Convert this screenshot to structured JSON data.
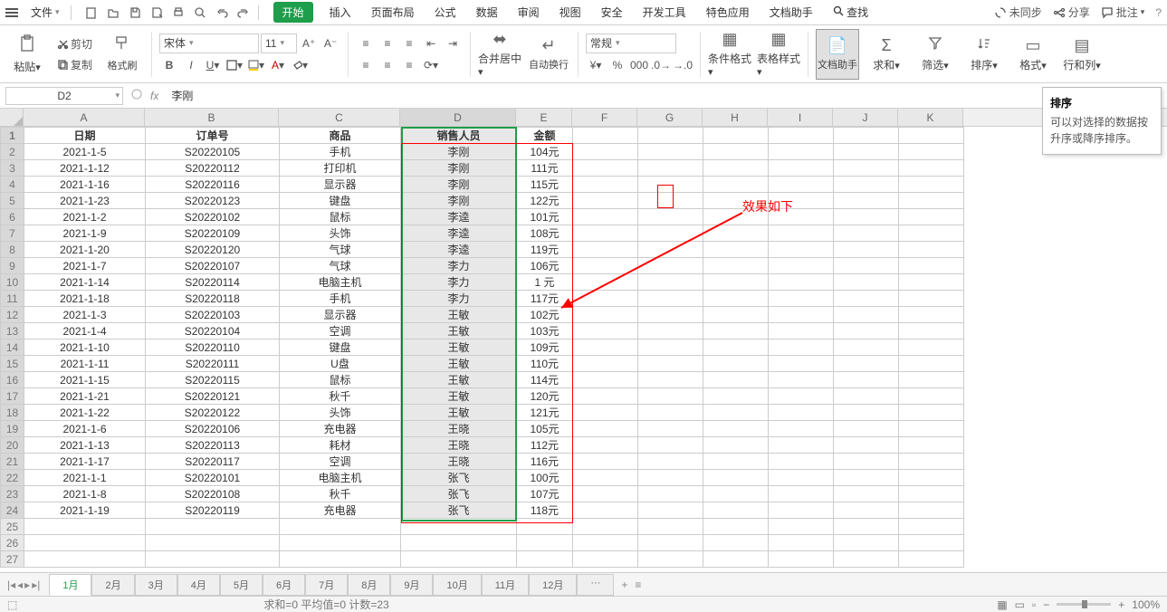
{
  "menu": {
    "file": "文件",
    "tabs": [
      "开始",
      "插入",
      "页面布局",
      "公式",
      "数据",
      "审阅",
      "视图",
      "安全",
      "开发工具",
      "特色应用",
      "文档助手"
    ],
    "search": "查找",
    "unsync": "未同步",
    "share": "分享",
    "comment": "批注"
  },
  "ribbon": {
    "paste": "粘贴",
    "cut": "剪切",
    "copy": "复制",
    "brush": "格式刷",
    "font": "宋体",
    "size": "11",
    "merge": "合并居中",
    "wrap": "自动换行",
    "numfmt": "常规",
    "cond": "条件格式",
    "tblstyle": "表格样式",
    "helper": "文档助手",
    "sum": "求和",
    "filter": "筛选",
    "sort": "排序",
    "format": "格式",
    "rowcol": "行和列"
  },
  "tooltip": {
    "title": "排序",
    "body": "可以对选择的数据按升序或降序排序。"
  },
  "namebox": "D2",
  "formula": "李刚",
  "cols": [
    "A",
    "B",
    "C",
    "D",
    "E",
    "F",
    "G",
    "H",
    "I",
    "J",
    "K"
  ],
  "headers": [
    "日期",
    "订单号",
    "商品",
    "销售人员",
    "金额"
  ],
  "rows": [
    [
      "2021-1-5",
      "S20220105",
      "手机",
      "李刚",
      "104元"
    ],
    [
      "2021-1-12",
      "S20220112",
      "打印机",
      "李刚",
      "111元"
    ],
    [
      "2021-1-16",
      "S20220116",
      "显示器",
      "李刚",
      "115元"
    ],
    [
      "2021-1-23",
      "S20220123",
      "键盘",
      "李刚",
      "122元"
    ],
    [
      "2021-1-2",
      "S20220102",
      "鼠标",
      "李逵",
      "101元"
    ],
    [
      "2021-1-9",
      "S20220109",
      "头饰",
      "李逵",
      "108元"
    ],
    [
      "2021-1-20",
      "S20220120",
      "气球",
      "李逵",
      "119元"
    ],
    [
      "2021-1-7",
      "S20220107",
      "气球",
      "李力",
      "106元"
    ],
    [
      "2021-1-14",
      "S20220114",
      "电脑主机",
      "李力",
      "1     元"
    ],
    [
      "2021-1-18",
      "S20220118",
      "手机",
      "李力",
      "117元"
    ],
    [
      "2021-1-3",
      "S20220103",
      "显示器",
      "王敏",
      "102元"
    ],
    [
      "2021-1-4",
      "S20220104",
      "空调",
      "王敏",
      "103元"
    ],
    [
      "2021-1-10",
      "S20220110",
      "键盘",
      "王敏",
      "109元"
    ],
    [
      "2021-1-11",
      "S20220111",
      "U盘",
      "王敏",
      "110元"
    ],
    [
      "2021-1-15",
      "S20220115",
      "鼠标",
      "王敏",
      "114元"
    ],
    [
      "2021-1-21",
      "S20220121",
      "秋千",
      "王敏",
      "120元"
    ],
    [
      "2021-1-22",
      "S20220122",
      "头饰",
      "王敏",
      "121元"
    ],
    [
      "2021-1-6",
      "S20220106",
      "充电器",
      "王晓",
      "105元"
    ],
    [
      "2021-1-13",
      "S20220113",
      "耗材",
      "王晓",
      "112元"
    ],
    [
      "2021-1-17",
      "S20220117",
      "空调",
      "王晓",
      "116元"
    ],
    [
      "2021-1-1",
      "S20220101",
      "电脑主机",
      "张飞",
      "100元"
    ],
    [
      "2021-1-8",
      "S20220108",
      "秋千",
      "张飞",
      "107元"
    ],
    [
      "2021-1-19",
      "S20220119",
      "充电器",
      "张飞",
      "118元"
    ]
  ],
  "annotation": "效果如下",
  "sheets": [
    "1月",
    "2月",
    "3月",
    "4月",
    "5月",
    "6月",
    "7月",
    "8月",
    "9月",
    "10月",
    "11月",
    "12月",
    "···"
  ],
  "status": {
    "info": "求和=0  平均值=0  计数=23",
    "zoom": "100%"
  }
}
